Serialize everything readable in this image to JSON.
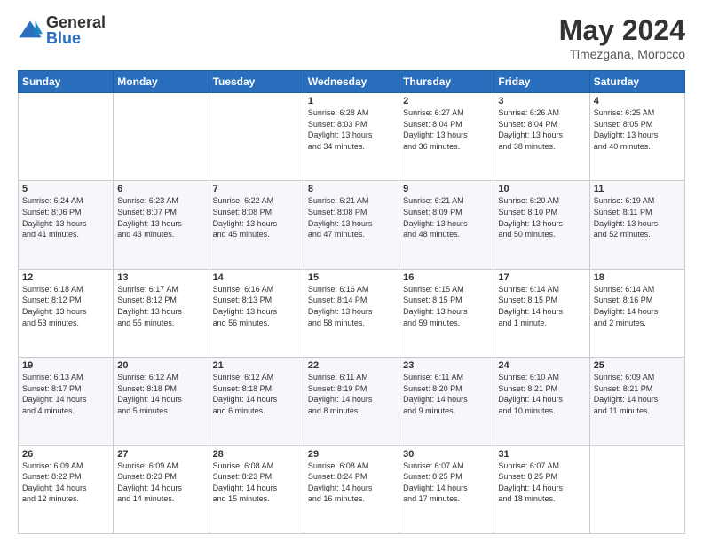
{
  "header": {
    "logo_general": "General",
    "logo_blue": "Blue",
    "title": "May 2024",
    "subtitle": "Timezgana, Morocco"
  },
  "days_of_week": [
    "Sunday",
    "Monday",
    "Tuesday",
    "Wednesday",
    "Thursday",
    "Friday",
    "Saturday"
  ],
  "weeks": [
    [
      {
        "day": "",
        "info": ""
      },
      {
        "day": "",
        "info": ""
      },
      {
        "day": "",
        "info": ""
      },
      {
        "day": "1",
        "info": "Sunrise: 6:28 AM\nSunset: 8:03 PM\nDaylight: 13 hours\nand 34 minutes."
      },
      {
        "day": "2",
        "info": "Sunrise: 6:27 AM\nSunset: 8:04 PM\nDaylight: 13 hours\nand 36 minutes."
      },
      {
        "day": "3",
        "info": "Sunrise: 6:26 AM\nSunset: 8:04 PM\nDaylight: 13 hours\nand 38 minutes."
      },
      {
        "day": "4",
        "info": "Sunrise: 6:25 AM\nSunset: 8:05 PM\nDaylight: 13 hours\nand 40 minutes."
      }
    ],
    [
      {
        "day": "5",
        "info": "Sunrise: 6:24 AM\nSunset: 8:06 PM\nDaylight: 13 hours\nand 41 minutes."
      },
      {
        "day": "6",
        "info": "Sunrise: 6:23 AM\nSunset: 8:07 PM\nDaylight: 13 hours\nand 43 minutes."
      },
      {
        "day": "7",
        "info": "Sunrise: 6:22 AM\nSunset: 8:08 PM\nDaylight: 13 hours\nand 45 minutes."
      },
      {
        "day": "8",
        "info": "Sunrise: 6:21 AM\nSunset: 8:08 PM\nDaylight: 13 hours\nand 47 minutes."
      },
      {
        "day": "9",
        "info": "Sunrise: 6:21 AM\nSunset: 8:09 PM\nDaylight: 13 hours\nand 48 minutes."
      },
      {
        "day": "10",
        "info": "Sunrise: 6:20 AM\nSunset: 8:10 PM\nDaylight: 13 hours\nand 50 minutes."
      },
      {
        "day": "11",
        "info": "Sunrise: 6:19 AM\nSunset: 8:11 PM\nDaylight: 13 hours\nand 52 minutes."
      }
    ],
    [
      {
        "day": "12",
        "info": "Sunrise: 6:18 AM\nSunset: 8:12 PM\nDaylight: 13 hours\nand 53 minutes."
      },
      {
        "day": "13",
        "info": "Sunrise: 6:17 AM\nSunset: 8:12 PM\nDaylight: 13 hours\nand 55 minutes."
      },
      {
        "day": "14",
        "info": "Sunrise: 6:16 AM\nSunset: 8:13 PM\nDaylight: 13 hours\nand 56 minutes."
      },
      {
        "day": "15",
        "info": "Sunrise: 6:16 AM\nSunset: 8:14 PM\nDaylight: 13 hours\nand 58 minutes."
      },
      {
        "day": "16",
        "info": "Sunrise: 6:15 AM\nSunset: 8:15 PM\nDaylight: 13 hours\nand 59 minutes."
      },
      {
        "day": "17",
        "info": "Sunrise: 6:14 AM\nSunset: 8:15 PM\nDaylight: 14 hours\nand 1 minute."
      },
      {
        "day": "18",
        "info": "Sunrise: 6:14 AM\nSunset: 8:16 PM\nDaylight: 14 hours\nand 2 minutes."
      }
    ],
    [
      {
        "day": "19",
        "info": "Sunrise: 6:13 AM\nSunset: 8:17 PM\nDaylight: 14 hours\nand 4 minutes."
      },
      {
        "day": "20",
        "info": "Sunrise: 6:12 AM\nSunset: 8:18 PM\nDaylight: 14 hours\nand 5 minutes."
      },
      {
        "day": "21",
        "info": "Sunrise: 6:12 AM\nSunset: 8:18 PM\nDaylight: 14 hours\nand 6 minutes."
      },
      {
        "day": "22",
        "info": "Sunrise: 6:11 AM\nSunset: 8:19 PM\nDaylight: 14 hours\nand 8 minutes."
      },
      {
        "day": "23",
        "info": "Sunrise: 6:11 AM\nSunset: 8:20 PM\nDaylight: 14 hours\nand 9 minutes."
      },
      {
        "day": "24",
        "info": "Sunrise: 6:10 AM\nSunset: 8:21 PM\nDaylight: 14 hours\nand 10 minutes."
      },
      {
        "day": "25",
        "info": "Sunrise: 6:09 AM\nSunset: 8:21 PM\nDaylight: 14 hours\nand 11 minutes."
      }
    ],
    [
      {
        "day": "26",
        "info": "Sunrise: 6:09 AM\nSunset: 8:22 PM\nDaylight: 14 hours\nand 12 minutes."
      },
      {
        "day": "27",
        "info": "Sunrise: 6:09 AM\nSunset: 8:23 PM\nDaylight: 14 hours\nand 14 minutes."
      },
      {
        "day": "28",
        "info": "Sunrise: 6:08 AM\nSunset: 8:23 PM\nDaylight: 14 hours\nand 15 minutes."
      },
      {
        "day": "29",
        "info": "Sunrise: 6:08 AM\nSunset: 8:24 PM\nDaylight: 14 hours\nand 16 minutes."
      },
      {
        "day": "30",
        "info": "Sunrise: 6:07 AM\nSunset: 8:25 PM\nDaylight: 14 hours\nand 17 minutes."
      },
      {
        "day": "31",
        "info": "Sunrise: 6:07 AM\nSunset: 8:25 PM\nDaylight: 14 hours\nand 18 minutes."
      },
      {
        "day": "",
        "info": ""
      }
    ]
  ],
  "colors": {
    "header_bg": "#2a6fbe",
    "accent": "#2a6fbe"
  }
}
